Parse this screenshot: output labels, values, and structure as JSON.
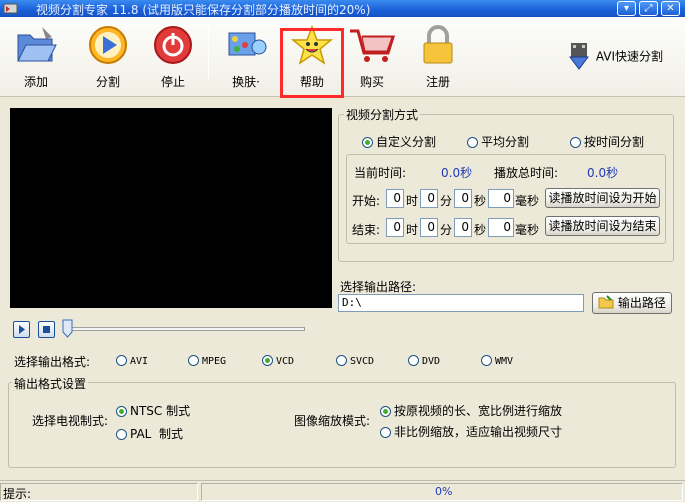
{
  "window": {
    "title": "视频分割专家 11.8 (试用版只能保存分割部分播放时间的20%)"
  },
  "toolbar": {
    "add": "添加",
    "split": "分割",
    "stop": "停止",
    "skin": "换肤·",
    "help": "帮助",
    "buy": "购买",
    "register": "注册",
    "avi_split": "AVI快速分割"
  },
  "split_mode": {
    "title": "视频分割方式",
    "options": [
      "自定义分割",
      "平均分割",
      "按时间分割"
    ],
    "selected": "自定义分割",
    "current_time_label": "当前时间:",
    "current_time_value": "0.0秒",
    "total_time_label": "播放总时间:",
    "total_time_value": "0.0秒",
    "start_label": "开始:",
    "end_label": "结束:",
    "unit_hour": "时",
    "unit_min": "分",
    "unit_sec": "秒",
    "unit_ms": "毫秒",
    "start": {
      "h": "0",
      "m": "0",
      "s": "0",
      "ms": "0"
    },
    "end": {
      "h": "0",
      "m": "0",
      "s": "0",
      "ms": "0"
    },
    "set_start_button": "读播放时间设为开始",
    "set_end_button": "读播放时间设为结束"
  },
  "output_path": {
    "label": "选择输出路径:",
    "value": "D:\\",
    "button": "输出路径"
  },
  "output_format": {
    "label": "选择输出格式:",
    "options": [
      "AVI",
      "MPEG",
      "VCD",
      "SVCD",
      "DVD",
      "WMV"
    ],
    "selected": "VCD"
  },
  "format_settings": {
    "title": "输出格式设置",
    "tv_label": "选择电视制式:",
    "tv_options": [
      "NTSC 制式",
      "PAL  制式"
    ],
    "tv_selected": "NTSC 制式",
    "scale_label": "图像缩放模式:",
    "scale_options": [
      "按原视频的长、宽比例进行缩放",
      "非比例缩放，适应输出视频尺寸"
    ],
    "scale_selected": "按原视频的长、宽比例进行缩放"
  },
  "status": {
    "hint_label": "提示:",
    "progress": "0%"
  },
  "colors": {
    "highlight": "#ff2a2a",
    "video_bg": "#000000",
    "accent_blue": "#1f3ab8"
  }
}
